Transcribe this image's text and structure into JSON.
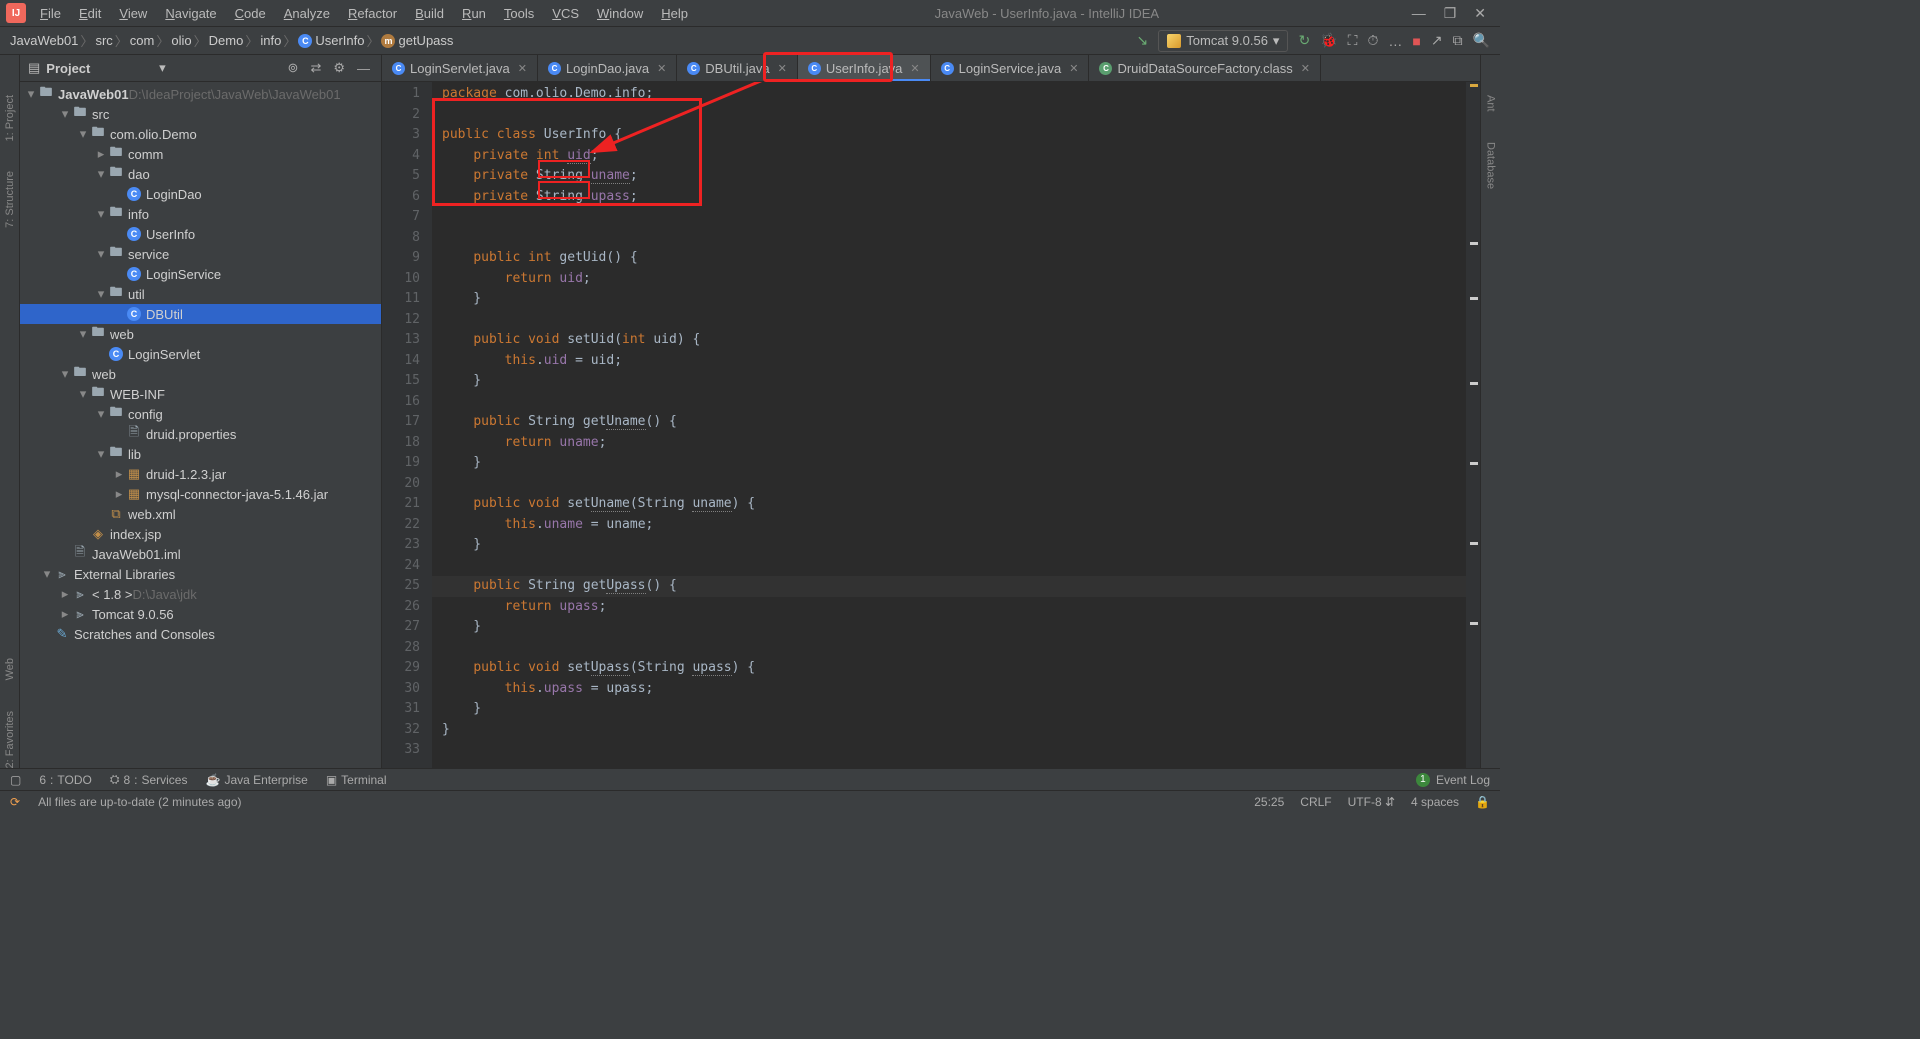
{
  "window": {
    "title": "JavaWeb - UserInfo.java - IntelliJ IDEA"
  },
  "menu": [
    "File",
    "Edit",
    "View",
    "Navigate",
    "Code",
    "Analyze",
    "Refactor",
    "Build",
    "Run",
    "Tools",
    "VCS",
    "Window",
    "Help"
  ],
  "breadcrumb": {
    "items": [
      "JavaWeb01",
      "src",
      "com",
      "olio",
      "Demo",
      "info",
      "UserInfo",
      "getUpass"
    ]
  },
  "runConfig": "Tomcat 9.0.56",
  "project": {
    "header": "Project",
    "root": {
      "name": "JavaWeb01",
      "path": "D:\\IdeaProject\\JavaWeb\\JavaWeb01"
    },
    "tree": [
      {
        "d": 1,
        "arrow": "▾",
        "icon": "folder",
        "label": "src"
      },
      {
        "d": 2,
        "arrow": "▾",
        "icon": "folder",
        "label": "com.olio.Demo"
      },
      {
        "d": 3,
        "arrow": "▸",
        "icon": "folder",
        "label": "comm"
      },
      {
        "d": 3,
        "arrow": "▾",
        "icon": "folder",
        "label": "dao"
      },
      {
        "d": 4,
        "arrow": "",
        "icon": "class",
        "label": "LoginDao"
      },
      {
        "d": 3,
        "arrow": "▾",
        "icon": "folder",
        "label": "info"
      },
      {
        "d": 4,
        "arrow": "",
        "icon": "class",
        "label": "UserInfo"
      },
      {
        "d": 3,
        "arrow": "▾",
        "icon": "folder",
        "label": "service"
      },
      {
        "d": 4,
        "arrow": "",
        "icon": "class",
        "label": "LoginService"
      },
      {
        "d": 3,
        "arrow": "▾",
        "icon": "folder",
        "label": "util"
      },
      {
        "d": 4,
        "arrow": "",
        "icon": "class",
        "label": "DBUtil",
        "selected": true
      },
      {
        "d": 2,
        "arrow": "▾",
        "icon": "folder",
        "label": "web"
      },
      {
        "d": 3,
        "arrow": "",
        "icon": "class",
        "label": "LoginServlet"
      },
      {
        "d": 1,
        "arrow": "▾",
        "icon": "folder",
        "label": "web"
      },
      {
        "d": 2,
        "arrow": "▾",
        "icon": "folder",
        "label": "WEB-INF"
      },
      {
        "d": 3,
        "arrow": "▾",
        "icon": "folder",
        "label": "config"
      },
      {
        "d": 4,
        "arrow": "",
        "icon": "file",
        "label": "druid.properties"
      },
      {
        "d": 3,
        "arrow": "▾",
        "icon": "folder",
        "label": "lib"
      },
      {
        "d": 4,
        "arrow": "▸",
        "icon": "jar",
        "label": "druid-1.2.3.jar"
      },
      {
        "d": 4,
        "arrow": "▸",
        "icon": "jar",
        "label": "mysql-connector-java-5.1.46.jar"
      },
      {
        "d": 3,
        "arrow": "",
        "icon": "xml",
        "label": "web.xml"
      },
      {
        "d": 2,
        "arrow": "",
        "icon": "jsp",
        "label": "index.jsp"
      },
      {
        "d": 1,
        "arrow": "",
        "icon": "file",
        "label": "JavaWeb01.iml"
      },
      {
        "d": 0,
        "arrow": "▾",
        "icon": "lib",
        "label": "External Libraries"
      },
      {
        "d": 1,
        "arrow": "▸",
        "icon": "lib",
        "label": "< 1.8 >",
        "gray": "D:\\Java\\jdk"
      },
      {
        "d": 1,
        "arrow": "▸",
        "icon": "lib",
        "label": "Tomcat 9.0.56"
      },
      {
        "d": 0,
        "arrow": "",
        "icon": "scratch",
        "label": "Scratches and Consoles"
      }
    ]
  },
  "tabs": [
    {
      "label": "LoginServlet.java",
      "active": false
    },
    {
      "label": "LoginDao.java",
      "active": false
    },
    {
      "label": "DBUtil.java",
      "active": false
    },
    {
      "label": "UserInfo.java",
      "active": true
    },
    {
      "label": "LoginService.java",
      "active": false
    },
    {
      "label": "DruidDataSourceFactory.class",
      "active": false,
      "decompiled": true
    }
  ],
  "code": {
    "lines": [
      {
        "n": 1,
        "html": "<span class='kw'>package</span> com.olio.Demo.info;"
      },
      {
        "n": 2,
        "html": ""
      },
      {
        "n": 3,
        "html": "<span class='kw'>public class</span> UserInfo {"
      },
      {
        "n": 4,
        "html": "    <span class='kw'>private int</span> <span class='field underwave'>uid</span>;"
      },
      {
        "n": 5,
        "html": "    <span class='kw'>private</span> String <span class='field underwave'>uname</span>;"
      },
      {
        "n": 6,
        "html": "    <span class='kw'>private</span> String <span class='field underwave'>upass</span>;"
      },
      {
        "n": 7,
        "html": ""
      },
      {
        "n": 8,
        "html": ""
      },
      {
        "n": 9,
        "html": "    <span class='kw'>public int</span> getUid() {"
      },
      {
        "n": 10,
        "html": "        <span class='kw'>return</span> <span class='field'>uid</span>;"
      },
      {
        "n": 11,
        "html": "    }"
      },
      {
        "n": 12,
        "html": ""
      },
      {
        "n": 13,
        "html": "    <span class='kw'>public void</span> setUid(<span class='kw'>int</span> uid) {"
      },
      {
        "n": 14,
        "html": "        <span class='kw'>this</span>.<span class='field'>uid</span> = uid;"
      },
      {
        "n": 15,
        "html": "    }"
      },
      {
        "n": 16,
        "html": ""
      },
      {
        "n": 17,
        "html": "    <span class='kw'>public</span> String get<span class='underwave'>Uname</span>() {"
      },
      {
        "n": 18,
        "html": "        <span class='kw'>return</span> <span class='field'>uname</span>;"
      },
      {
        "n": 19,
        "html": "    }"
      },
      {
        "n": 20,
        "html": ""
      },
      {
        "n": 21,
        "html": "    <span class='kw'>public void</span> set<span class='underwave'>Uname</span>(String <span class='underwave'>uname</span>) {"
      },
      {
        "n": 22,
        "html": "        <span class='kw'>this</span>.<span class='field'>uname</span> = uname;"
      },
      {
        "n": 23,
        "html": "    }"
      },
      {
        "n": 24,
        "html": ""
      },
      {
        "n": 25,
        "html": "    <span class='kw'>public</span> String get<span class='underwave'>Upass</span>() {"
      },
      {
        "n": 26,
        "html": "        <span class='kw'>return</span> <span class='field'>upass</span>;"
      },
      {
        "n": 27,
        "html": "    }"
      },
      {
        "n": 28,
        "html": ""
      },
      {
        "n": 29,
        "html": "    <span class='kw'>public void</span> set<span class='underwave'>Upass</span>(String <span class='underwave'>upass</span>) {"
      },
      {
        "n": 30,
        "html": "        <span class='kw'>this</span>.<span class='field'>upass</span> = upass;"
      },
      {
        "n": 31,
        "html": "    }"
      },
      {
        "n": 32,
        "html": "}"
      },
      {
        "n": 33,
        "html": ""
      }
    ],
    "caretLine": 25
  },
  "bottomTools": [
    "TODO",
    "Services",
    "Java Enterprise",
    "Terminal"
  ],
  "bottomNums": [
    "6",
    "8"
  ],
  "eventLog": "Event Log",
  "status": {
    "msg": "All files are up-to-date (2 minutes ago)",
    "pos": "25:25",
    "eol": "CRLF",
    "enc": "UTF-8",
    "indent": "4 spaces"
  },
  "leftTools": [
    "1: Project",
    "7: Structure"
  ],
  "leftBottom": [
    "Web",
    "2: Favorites"
  ],
  "rightTools": [
    "Ant",
    "Database"
  ]
}
